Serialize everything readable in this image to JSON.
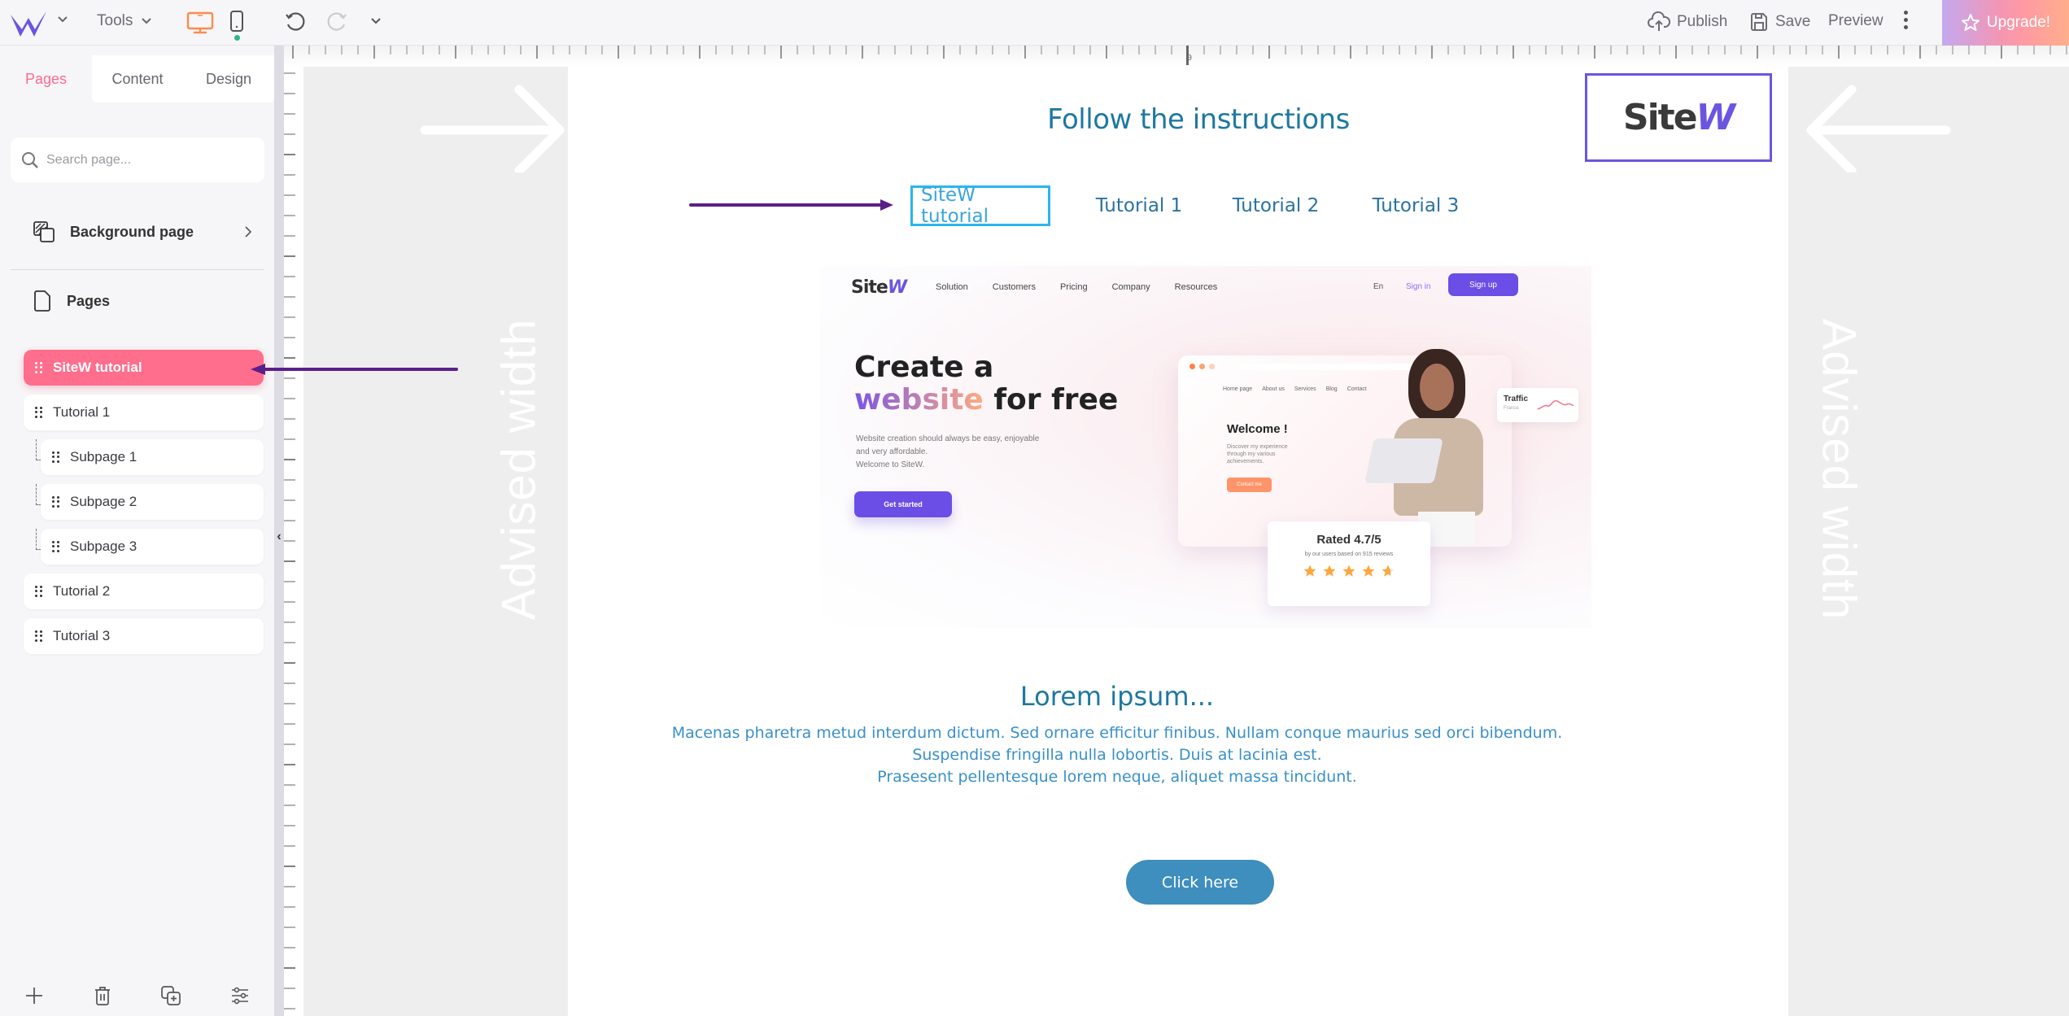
{
  "topbar": {
    "tools_label": "Tools",
    "publish_label": "Publish",
    "save_label": "Save",
    "preview_label": "Preview",
    "upgrade_label": "Upgrade!",
    "device_active": "desktop",
    "colors": {
      "logo": "#6b55e0",
      "device_active": "#ff8a4c",
      "upgrade_gradient_start": "#c3a9ef",
      "upgrade_gradient_end": "#ffae8c"
    }
  },
  "sidebar": {
    "tabs": [
      {
        "label": "Pages",
        "active": true
      },
      {
        "label": "Content",
        "active": false
      },
      {
        "label": "Design",
        "active": false
      }
    ],
    "search": {
      "placeholder": "Search page..."
    },
    "background_page_label": "Background page",
    "pages_section_label": "Pages",
    "pages": [
      {
        "label": "SiteW tutorial",
        "active": true,
        "level": 0
      },
      {
        "label": "Tutorial 1",
        "active": false,
        "level": 0
      },
      {
        "label": "Subpage 1",
        "active": false,
        "level": 1
      },
      {
        "label": "Subpage 2",
        "active": false,
        "level": 1
      },
      {
        "label": "Subpage 3",
        "active": false,
        "level": 1
      },
      {
        "label": "Tutorial 2",
        "active": false,
        "level": 0
      },
      {
        "label": "Tutorial 3",
        "active": false,
        "level": 0
      }
    ],
    "active_color": "#ff6e8c"
  },
  "ruler": {
    "origin_label": "0"
  },
  "canvas": {
    "advised_width_label": "Advised width",
    "title": "Follow the instructions",
    "logo_text": "SiteW",
    "nav": [
      {
        "label": "SiteW tutorial",
        "selected": true
      },
      {
        "label": "Tutorial 1",
        "selected": false
      },
      {
        "label": "Tutorial 2",
        "selected": false
      },
      {
        "label": "Tutorial 3",
        "selected": false
      }
    ],
    "hero": {
      "logo": "SiteW",
      "menu": [
        "Solution",
        "Customers",
        "Pricing",
        "Company",
        "Resources"
      ],
      "lang": "En",
      "signin": "Sign in",
      "signup": "Sign up",
      "headline_1": "Create a",
      "headline_accent": "website",
      "headline_2": "for free",
      "subtext_1": "Website creation should always be easy, enjoyable",
      "subtext_2": "and very affordable.",
      "subtext_3": "Welcome to SiteW.",
      "cta": "Get started",
      "mock_menu": [
        "Home page",
        "About us",
        "Services",
        "Blog",
        "Contact"
      ],
      "mock_title": "Welcome !",
      "mock_text_1": "Discover my experience",
      "mock_text_2": "through my various",
      "mock_text_3": "achievements.",
      "mock_cta": "Contact me",
      "traffic_title": "Traffic",
      "traffic_sub": "France",
      "rating_title": "Rated 4.7/5",
      "rating_sub": "by our users based on 915 reviews",
      "rating_value": 4.7,
      "rating_max": 5
    },
    "lorem_title": "Lorem ipsum...",
    "lorem_lines": [
      "Macenas pharetra metud interdum dictum. Sed ornare efficitur finibus. Nullam conque maurius sed orci bibendum.",
      "Suspendise fringilla nulla lobortis. Duis at lacinia est.",
      "Prasesent pellentesque lorem neque, aliquet massa tincidunt."
    ],
    "button_label": "Click here",
    "colors": {
      "title": "#1e78a0",
      "body": "#3a90c8",
      "button": "#3e8ebe",
      "selected_border": "#2ab6ee",
      "logo_border": "#6b55e0",
      "arrow": "#5b1f8a"
    }
  }
}
